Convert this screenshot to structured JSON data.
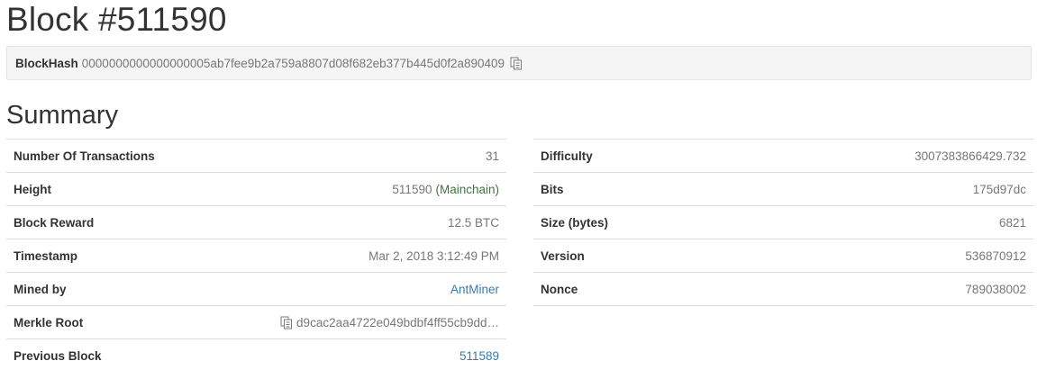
{
  "page": {
    "title": "Block #511590"
  },
  "blockhash": {
    "label": "BlockHash",
    "value": "0000000000000000005ab7fee9b2a759a8807d08f682eb377b445d0f2a890409"
  },
  "summary": {
    "title": "Summary",
    "left_rows": [
      {
        "label": "Number Of Transactions",
        "value": "31"
      },
      {
        "label": "Height",
        "value": "511590",
        "extra": "(Mainchain)"
      },
      {
        "label": "Block Reward",
        "value": "12.5 BTC"
      },
      {
        "label": "Timestamp",
        "value": "Mar 2, 2018 3:12:49 PM"
      },
      {
        "label": "Mined by",
        "value": "AntMiner"
      },
      {
        "label": "Merkle Root",
        "value": "d9cac2aa4722e049bdbf4ff55cb9dd…"
      },
      {
        "label": "Previous Block",
        "value": "511589"
      }
    ],
    "right_rows": [
      {
        "label": "Difficulty",
        "value": "3007383866429.732"
      },
      {
        "label": "Bits",
        "value": "175d97dc"
      },
      {
        "label": "Size (bytes)",
        "value": "6821"
      },
      {
        "label": "Version",
        "value": "536870912"
      },
      {
        "label": "Nonce",
        "value": "789038002"
      }
    ]
  },
  "icons": {
    "copy": "copy-icon"
  },
  "colors": {
    "link": "#337ab7",
    "muted": "#777777",
    "mainchain": "#3c763d"
  }
}
